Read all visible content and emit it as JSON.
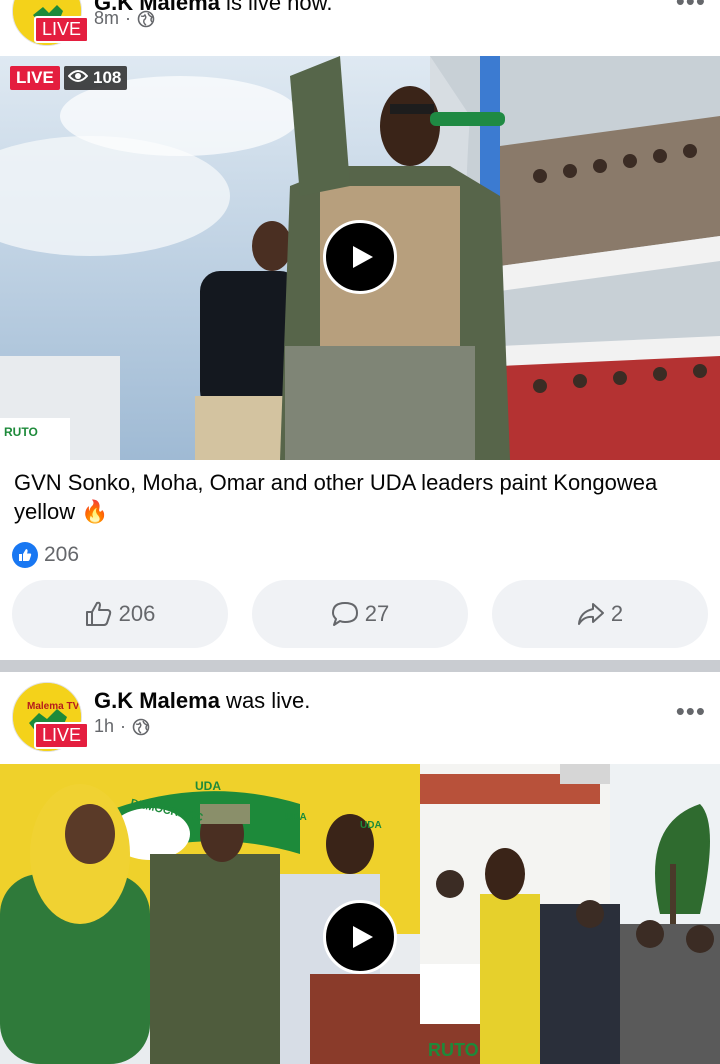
{
  "post1": {
    "author": "G.K Malema",
    "status": " is live now.",
    "time": "8m",
    "avatar_badge": "LIVE",
    "video": {
      "live_label": "LIVE",
      "viewers": "108",
      "banner_text": "RUTO"
    },
    "caption": "GVN Sonko, Moha, Omar and other UDA leaders paint Kongowea yellow",
    "caption_emoji": "🔥",
    "reaction_count": "206",
    "actions": {
      "like_count": "206",
      "comment_count": "27",
      "share_count": "2"
    }
  },
  "post2": {
    "author": "G.K Malema",
    "status": " was live.",
    "time": "1h",
    "avatar_badge": "LIVE",
    "avatar_text": "Malema TV",
    "video": {
      "banner_texts": [
        "UDA",
        "DEMOCRATIC",
        "UDA",
        "UDA",
        "RUTO"
      ]
    }
  },
  "colors": {
    "live_red": "#e41e3f",
    "facebook_blue": "#1877f2",
    "uda_yellow": "#f4d21a",
    "divider": "#c9ccd1",
    "button_bg": "#f0f2f5"
  },
  "icons": [
    "globe-icon",
    "eye-icon",
    "play-icon",
    "thumbs-up-icon",
    "comment-icon",
    "share-icon",
    "more-icon",
    "like-reaction-icon",
    "fire-emoji"
  ]
}
